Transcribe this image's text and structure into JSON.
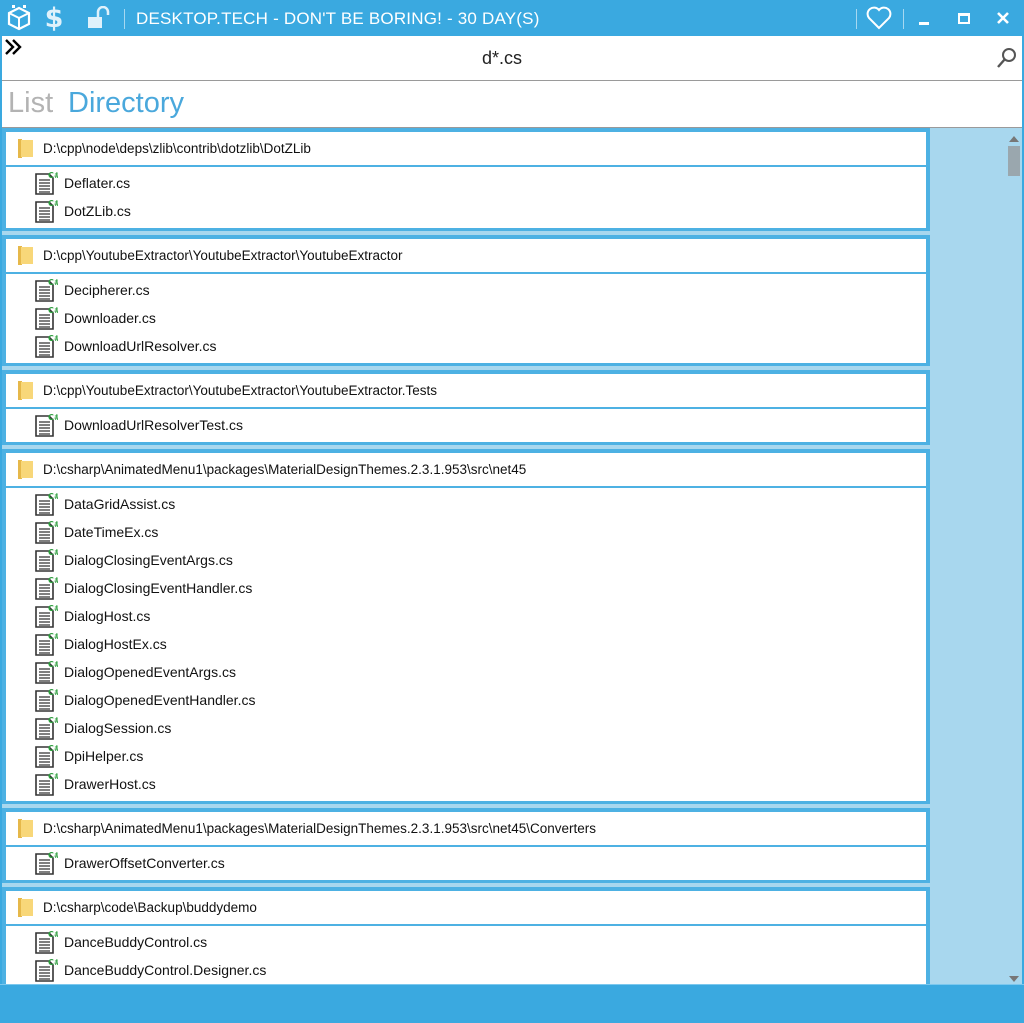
{
  "window": {
    "title": "DESKTOP.TECH - DON'T BE BORING! - 30 DAY(S)",
    "accent": "#3aa9e0"
  },
  "toolbar": {
    "icons": [
      "app-logo-icon",
      "dollar-icon",
      "unlock-icon",
      "heart-icon",
      "minimize-icon",
      "maximize-icon",
      "close-icon"
    ]
  },
  "search": {
    "value": "d*.cs",
    "expand_icon": "double-chevron-right-icon",
    "search_icon": "search-icon"
  },
  "tabs": [
    {
      "label": "List",
      "active": false
    },
    {
      "label": "Directory",
      "active": true
    }
  ],
  "groups": [
    {
      "path": "D:\\cpp\\node\\deps\\zlib\\contrib\\dotzlib\\DotZLib",
      "files": [
        "Deflater.cs",
        "DotZLib.cs"
      ]
    },
    {
      "path": "D:\\cpp\\YoutubeExtractor\\YoutubeExtractor\\YoutubeExtractor",
      "files": [
        "Decipherer.cs",
        "Downloader.cs",
        "DownloadUrlResolver.cs"
      ]
    },
    {
      "path": "D:\\cpp\\YoutubeExtractor\\YoutubeExtractor\\YoutubeExtractor.Tests",
      "files": [
        "DownloadUrlResolverTest.cs"
      ]
    },
    {
      "path": "D:\\csharp\\AnimatedMenu1\\packages\\MaterialDesignThemes.2.3.1.953\\src\\net45",
      "files": [
        "DataGridAssist.cs",
        "DateTimeEx.cs",
        "DialogClosingEventArgs.cs",
        "DialogClosingEventHandler.cs",
        "DialogHost.cs",
        "DialogHostEx.cs",
        "DialogOpenedEventArgs.cs",
        "DialogOpenedEventHandler.cs",
        "DialogSession.cs",
        "DpiHelper.cs",
        "DrawerHost.cs"
      ]
    },
    {
      "path": "D:\\csharp\\AnimatedMenu1\\packages\\MaterialDesignThemes.2.3.1.953\\src\\net45\\Converters",
      "files": [
        "DrawerOffsetConverter.cs"
      ]
    },
    {
      "path": "D:\\csharp\\code\\Backup\\buddydemo",
      "files": [
        "DanceBuddyControl.cs",
        "DanceBuddyControl.Designer.cs"
      ]
    }
  ]
}
